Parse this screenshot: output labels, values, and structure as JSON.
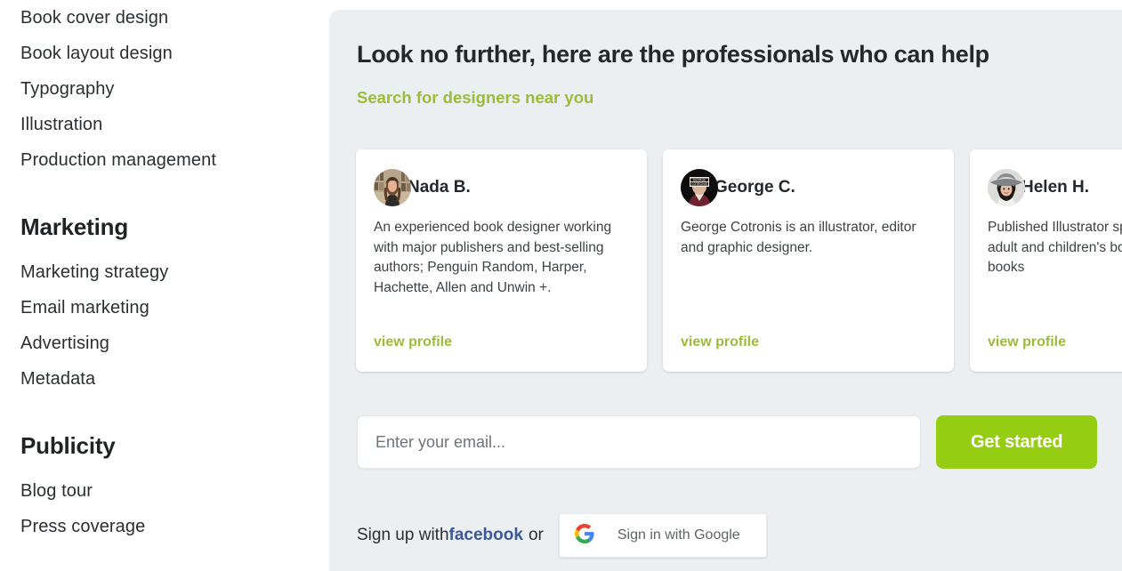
{
  "sidebar": {
    "groups": [
      {
        "heading": null,
        "items": [
          {
            "label": "Book cover design"
          },
          {
            "label": "Book layout design"
          },
          {
            "label": "Typography"
          },
          {
            "label": "Illustration"
          },
          {
            "label": "Production management"
          }
        ]
      },
      {
        "heading": "Marketing",
        "items": [
          {
            "label": "Marketing strategy"
          },
          {
            "label": "Email marketing"
          },
          {
            "label": "Advertising"
          },
          {
            "label": "Metadata"
          }
        ]
      },
      {
        "heading": "Publicity",
        "items": [
          {
            "label": "Blog tour"
          },
          {
            "label": "Press coverage"
          }
        ]
      }
    ]
  },
  "main": {
    "headline": "Look no further, here are the professionals who can help",
    "search_link": "Search for designers near you",
    "cards": [
      {
        "name": "Nada B.",
        "bio": "An experienced book designer working with major publishers and best-selling authors; Penguin Random, Harper, Hachette, Allen and Unwin +.",
        "cta": "view profile",
        "avatar_icon": "photo-woman-bookshelf-avatar"
      },
      {
        "name": "George C.",
        "bio": "George Cotronis is an illustrator, editor and graphic designer.",
        "cta": "view profile",
        "avatar_icon": "photo-dark-portrait-avatar"
      },
      {
        "name": "Helen H.",
        "bio": "Published Illustrator specialising in young adult and children's book covers, picture books",
        "cta": "view profile",
        "avatar_icon": "photo-woman-hat-avatar"
      }
    ],
    "signup": {
      "email_placeholder": "Enter your email...",
      "email_value": "",
      "get_started_label": "Get started",
      "signup_prefix": "Sign up with ",
      "facebook_label": "facebook",
      "or_label": "or",
      "google_label": "Sign in with Google",
      "google_icon": "google-g-icon"
    }
  },
  "colors": {
    "accent_green": "#9cbb3b",
    "button_green": "#95cd12",
    "panel_bg": "#eceff1",
    "facebook_blue": "#3b5998",
    "text_dark": "#23282c"
  }
}
